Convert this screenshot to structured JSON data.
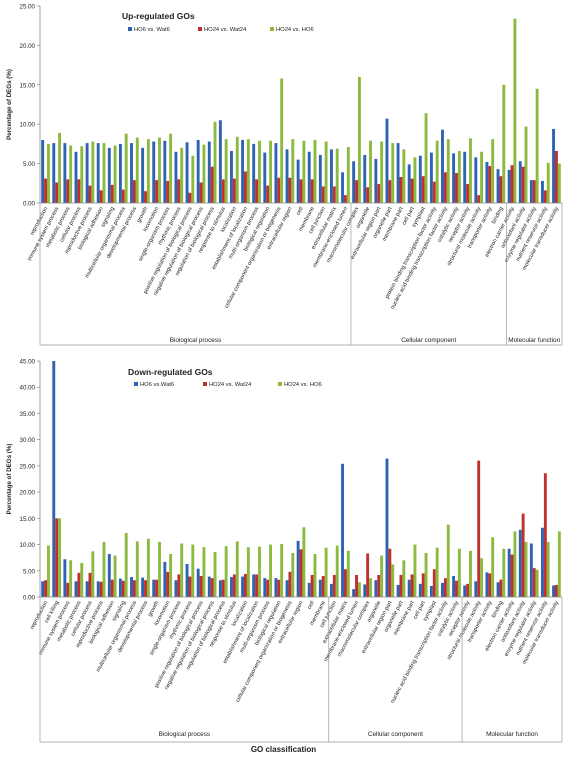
{
  "figure": {
    "xlabel": "GO classification"
  },
  "chart_data": [
    {
      "type": "bar",
      "title": "Up-regulated GOs",
      "ylabel": "Percentage of DEGs (%)",
      "ylim": [
        0,
        25
      ],
      "yticks": [
        "0.00",
        "5.00",
        "10.00",
        "15.00",
        "20.00",
        "25.00"
      ],
      "grid": false,
      "legend_position": "top",
      "groups": [
        {
          "label": "Biological process",
          "count": 28
        },
        {
          "label": "Cellular component",
          "count": 14
        },
        {
          "label": "Molecular function",
          "count": 12
        }
      ],
      "categories": [
        "reproduction",
        "immune system process",
        "metabolic process",
        "cellular process",
        "reproductive process",
        "biological adhesion",
        "signaling",
        "multicellular organismal process",
        "developmental process",
        "growth",
        "locomotion",
        "single-organism process",
        "rhythmic process",
        "positive regulation of biological process",
        "negative regulation of biological process",
        "regulation of biological process",
        "response to stimulus",
        "localization",
        "establishment of localization",
        "multi-organism process",
        "biological regulation",
        "cellular component organization or biogenesis",
        "extracellular region",
        "cell",
        "membrane",
        "cell junction",
        "extracellular matrix",
        "membrane-enclosed lumen",
        "macromolecular complex",
        "organelle",
        "extracellular region part",
        "organelle part",
        "membrane part",
        "cell part",
        "symplast",
        "protein binding transcription factor activity",
        "nucleic acid binding transcription factor activity",
        "catalytic activity",
        "receptor activity",
        "structural molecule activity",
        "transporter activity",
        "binding",
        "electron carrier activity",
        "antioxidant activity",
        "enzyme regulator activity",
        "nutrient reservoir activity",
        "molecular transducer activity"
      ],
      "series": [
        {
          "name": "HO6 vs. Wat6",
          "color": "#2e62b2",
          "values": [
            8.0,
            7.6,
            7.6,
            6.5,
            7.6,
            7.6,
            7.0,
            7.5,
            7.6,
            7.0,
            7.8,
            7.9,
            6.5,
            7.7,
            8.0,
            7.8,
            10.5,
            6.6,
            8.0,
            7.5,
            6.4,
            7.6,
            6.8,
            5.5,
            6.5,
            6.1,
            6.8,
            3.9,
            5.3,
            6.1,
            5.6,
            10.7,
            7.6,
            4.9,
            6.0,
            6.4,
            9.3,
            6.3,
            6.5,
            5.8,
            5.2,
            4.3,
            4.2,
            5.3,
            2.9,
            2.8,
            9.4
          ]
        },
        {
          "name": "HO24 vs. Wat24",
          "color": "#c0302e",
          "values": [
            3.1,
            2.6,
            3.0,
            3.0,
            2.2,
            1.6,
            2.3,
            1.7,
            2.9,
            1.5,
            2.9,
            2.8,
            3.0,
            1.3,
            2.6,
            4.6,
            3.0,
            3.1,
            4.0,
            3.0,
            2.2,
            3.2,
            3.2,
            3.0,
            3.0,
            2.1,
            2.1,
            1.0,
            2.9,
            2.0,
            2.4,
            2.9,
            3.3,
            3.1,
            3.4,
            2.7,
            3.9,
            3.8,
            2.4,
            1.0,
            4.7,
            3.4,
            4.8,
            4.6,
            2.9,
            1.6,
            6.6
          ]
        },
        {
          "name": "HO24 vs. HO6",
          "color": "#8cba3f",
          "values": [
            7.5,
            8.9,
            7.3,
            7.2,
            7.8,
            7.6,
            7.3,
            8.8,
            8.3,
            8.1,
            8.3,
            8.8,
            7.0,
            6.0,
            7.4,
            10.3,
            8.1,
            8.4,
            8.1,
            7.9,
            7.9,
            15.8,
            8.1,
            7.9,
            8.0,
            7.8,
            6.9,
            7.1,
            16.0,
            7.9,
            7.8,
            7.6,
            6.8,
            5.8,
            11.4,
            7.9,
            8.1,
            6.6,
            8.2,
            6.5,
            8.1,
            15.0,
            23.4,
            9.7,
            14.5,
            5.1,
            5.0
          ]
        }
      ]
    },
    {
      "type": "bar",
      "title": "Down-regulated GOs",
      "ylabel": "Percentage of DEGs (%)",
      "xlabel": "GO classification",
      "ylim": [
        0,
        45
      ],
      "yticks": [
        "0.00",
        "5.00",
        "10.00",
        "15.00",
        "20.00",
        "25.00",
        "30.00",
        "35.00",
        "40.00",
        "45.00"
      ],
      "grid": false,
      "legend_position": "top",
      "groups": [
        {
          "label": "Biological process",
          "count": 26
        },
        {
          "label": "Cellular component",
          "count": 12
        },
        {
          "label": "Molecular function",
          "count": 11
        }
      ],
      "categories": [
        "reproduction",
        "cell killing",
        "immune system process",
        "metabolic process",
        "cellular process",
        "reproductive process",
        "biological adhesion",
        "signaling",
        "multicellular organismal process",
        "developmental process",
        "growth",
        "locomotion",
        "single-organism process",
        "rhythmic process",
        "positive regulation of biological process",
        "negative regulation of biological process",
        "regulation of biological process",
        "response to stimulus",
        "localization",
        "establishment of localization",
        "multi-organism process",
        "biological regulation",
        "cellular component organization or biogenesis",
        "extracellular region",
        "cell",
        "membrane",
        "cell junction",
        "extracellular matrix",
        "membrane-enclosed lumen",
        "macromolecular complex",
        "organelle",
        "extracellular region part",
        "organelle part",
        "membrane part",
        "cell part",
        "symplast",
        "nucleic acid binding transcription factor activity",
        "catalytic activity",
        "receptor activity",
        "structural molecule activity",
        "transporter activity",
        "binding",
        "electron carrier activity",
        "antioxidant activity",
        "enzyme regulator activity",
        "nutrient reservoir activity",
        "molecular transducer activity"
      ],
      "series": [
        {
          "name": "HO6 vs.Wat6",
          "color": "#2e62b2",
          "values": [
            3.0,
            45.0,
            7.2,
            3.0,
            3.0,
            3.0,
            8.2,
            3.5,
            3.8,
            3.7,
            3.3,
            6.7,
            3.2,
            6.3,
            5.4,
            3.9,
            3.2,
            3.8,
            3.9,
            4.3,
            3.6,
            3.6,
            3.2,
            10.7,
            2.7,
            3.3,
            2.5,
            25.4,
            1.5,
            2.4,
            3.2,
            26.4,
            2.3,
            3.3,
            2.5,
            2.1,
            2.7,
            4.0,
            2.2,
            3.0,
            4.7,
            2.8,
            9.2,
            12.8,
            10.2,
            13.2,
            2.2
          ]
        },
        {
          "name": "HO24 vs. Wat24",
          "color": "#c0302e",
          "values": [
            3.2,
            15.0,
            2.7,
            4.6,
            4.6,
            2.9,
            3.3,
            3.1,
            3.2,
            3.2,
            3.3,
            4.8,
            4.3,
            3.9,
            4.0,
            3.6,
            3.3,
            4.3,
            4.4,
            4.3,
            3.3,
            3.3,
            4.8,
            9.1,
            4.2,
            4.0,
            4.2,
            5.3,
            4.2,
            8.3,
            4.2,
            9.2,
            4.2,
            4.3,
            4.5,
            5.3,
            3.6,
            3.1,
            2.5,
            26.0,
            4.5,
            3.3,
            8.1,
            15.9,
            5.5,
            23.6,
            2.3
          ]
        },
        {
          "name": "HO24 vs. HO6",
          "color": "#8cba3f",
          "values": [
            9.8,
            15.0,
            7.0,
            6.5,
            8.7,
            10.5,
            7.9,
            12.2,
            10.6,
            11.1,
            10.5,
            8.2,
            10.2,
            10.0,
            9.5,
            8.6,
            9.7,
            10.6,
            9.5,
            9.6,
            10.0,
            10.1,
            8.4,
            13.3,
            8.2,
            9.4,
            9.8,
            8.8,
            2.8,
            3.6,
            7.9,
            6.2,
            7.0,
            10.0,
            8.4,
            9.4,
            13.8,
            9.2,
            8.8,
            7.4,
            11.4,
            9.2,
            12.5,
            10.5,
            5.2,
            10.5,
            12.5
          ]
        }
      ]
    }
  ]
}
